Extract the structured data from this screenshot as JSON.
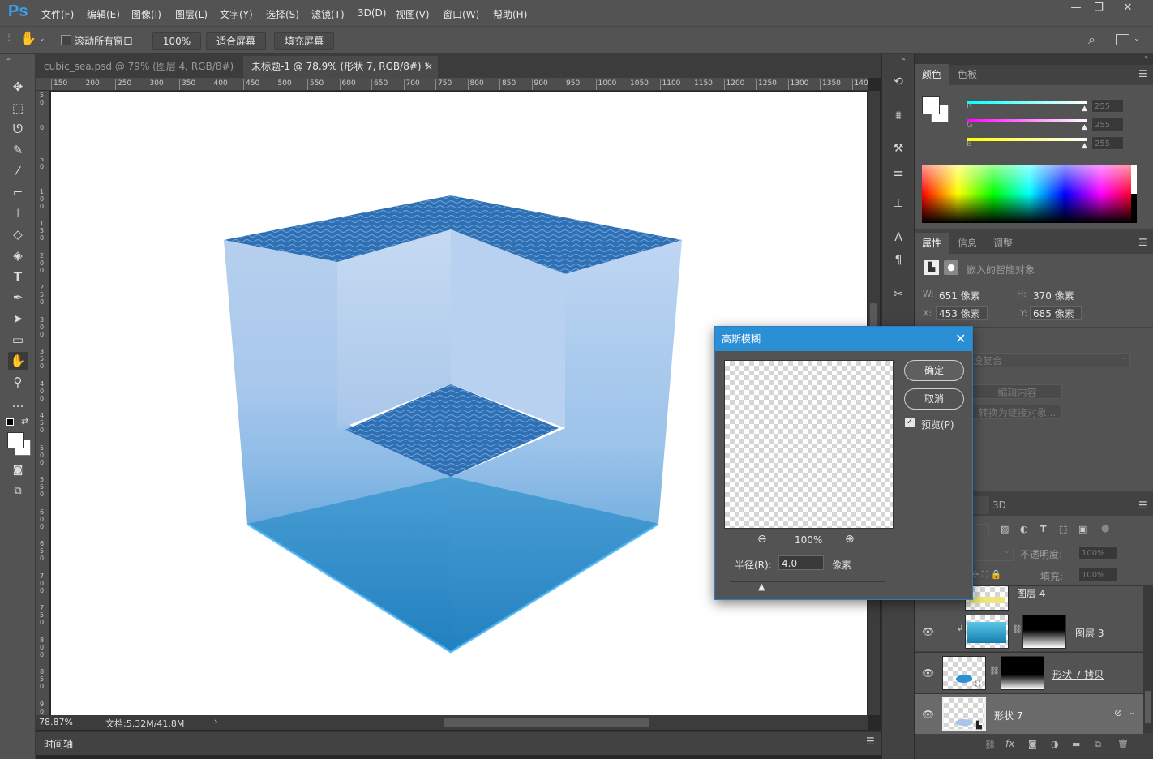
{
  "app": {
    "logo": "Ps"
  },
  "menu": [
    "文件(F)",
    "编辑(E)",
    "图像(I)",
    "图层(L)",
    "文字(Y)",
    "选择(S)",
    "滤镜(T)",
    "3D(D)",
    "视图(V)",
    "窗口(W)",
    "帮助(H)"
  ],
  "window_controls": {
    "minimize": "—",
    "restore": "❐",
    "close": "✕"
  },
  "options_bar": {
    "scroll_all_label": "滚动所有窗口",
    "zoom_value": "100%",
    "fit_screen_label": "适合屏幕",
    "fill_screen_label": "填充屏幕"
  },
  "tabs": [
    {
      "label": "cubic_sea.psd @ 79% (图层 4, RGB/8#) *",
      "close": "×",
      "active": false
    },
    {
      "label": "未标题-1 @ 78.9% (形状 7, RGB/8#) *",
      "close": "×",
      "active": true
    }
  ],
  "ruler_h": [
    "150",
    "200",
    "250",
    "300",
    "350",
    "400",
    "450",
    "500",
    "550",
    "600",
    "650",
    "700",
    "750",
    "800",
    "850",
    "900",
    "950",
    "1000",
    "1050",
    "1100",
    "1150",
    "1200",
    "1250",
    "1300",
    "1350",
    "140"
  ],
  "ruler_v": [
    "50",
    "0",
    "50",
    "100",
    "150",
    "200",
    "250",
    "300",
    "350",
    "400",
    "450",
    "500",
    "550",
    "600",
    "650",
    "700",
    "750",
    "800",
    "850",
    "900",
    "950"
  ],
  "status": {
    "zoom": "78.87%",
    "doc": "文档:5.32M/41.8M",
    "arrow": "›"
  },
  "timeline": {
    "label": "时间轴"
  },
  "color_panel": {
    "tabs": [
      "颜色",
      "色板"
    ],
    "channels": [
      {
        "label": "R",
        "value": "255",
        "color": "#ff4040"
      },
      {
        "label": "G",
        "value": "255",
        "color": "#40ff40"
      },
      {
        "label": "B",
        "value": "255",
        "color": "#4040ff"
      }
    ]
  },
  "properties_panel": {
    "tabs": [
      "属性",
      "信息",
      "调整"
    ],
    "type_label": "嵌入的智能对象",
    "w_label": "W:",
    "w_value": "651 像素",
    "h_label": "H:",
    "h_value": "370 像素",
    "x_label": "X:",
    "x_value": "453 像素",
    "y_label": "Y:",
    "y_value": "685 像素",
    "comp_select": "没复合",
    "edit_contents": "编辑内容",
    "convert_link": "转换为链接对象..."
  },
  "layers_panel": {
    "tab_3d": "3D",
    "opacity_label": "不透明度:",
    "opacity_value": "100%",
    "fill_label": "填充:",
    "fill_value": "100%",
    "layers": [
      {
        "name": "图层 4",
        "visible": false
      },
      {
        "name": "图层 3",
        "visible": true
      },
      {
        "name": "形状 7 拷贝",
        "visible": true
      },
      {
        "name": "形状 7",
        "visible": true,
        "selected": true
      }
    ]
  },
  "dialog": {
    "title": "高斯模糊",
    "ok": "确定",
    "cancel": "取消",
    "preview_label": "预览(P)",
    "preview_checked": true,
    "zoom": "100%",
    "radius_label": "半径(R):",
    "radius_value": "4.0",
    "radius_unit": "像素",
    "zoom_out": "⊖",
    "zoom_in": "⊕"
  }
}
